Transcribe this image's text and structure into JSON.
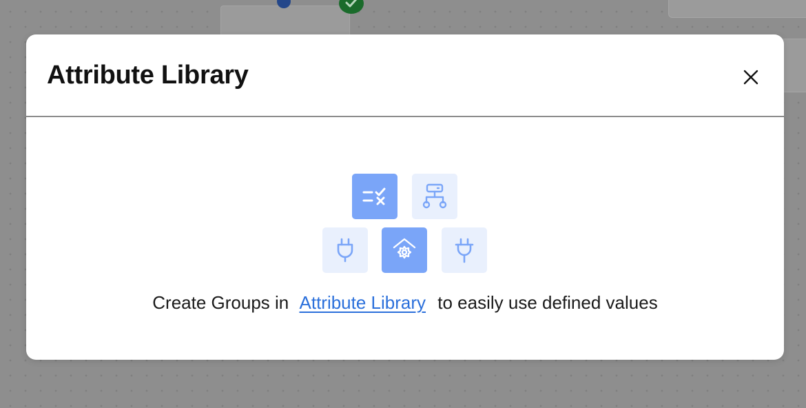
{
  "background": {
    "canvas_color": "#8e8e8e",
    "node_status_icon": "check-circle-icon"
  },
  "modal": {
    "title": "Attribute Library",
    "close_icon": "close-icon",
    "illustration": {
      "tiles": [
        {
          "icon": "checklist-icon",
          "style": "accent"
        },
        {
          "icon": "network-icon",
          "style": "light"
        },
        {
          "icon": "plug-icon",
          "style": "light"
        },
        {
          "icon": "home-gear-icon",
          "style": "accent"
        },
        {
          "icon": "plug-icon",
          "style": "light"
        }
      ],
      "accent_color": "#7aa5f8",
      "light_color": "#e9f0fd"
    },
    "message": {
      "prefix": "Create Groups in",
      "link_text": "Attribute Library",
      "suffix": "to easily use defined values",
      "link_color": "#2a6fdb"
    }
  }
}
